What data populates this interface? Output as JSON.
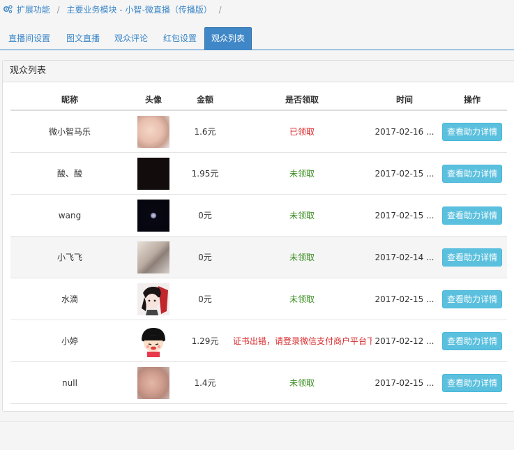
{
  "breadcrumb": {
    "items": [
      "扩展功能",
      "主要业务模块 - 小智-微直播（传播版）"
    ],
    "separator": "/"
  },
  "tabs": [
    {
      "label": "直播间设置",
      "active": false
    },
    {
      "label": "图文直播",
      "active": false
    },
    {
      "label": "观众评论",
      "active": false
    },
    {
      "label": "红包设置",
      "active": false
    },
    {
      "label": "观众列表",
      "active": true
    }
  ],
  "panel": {
    "title": "观众列表"
  },
  "table": {
    "headers": [
      "昵称",
      "头像",
      "金额",
      "是否领取",
      "时间",
      "操作"
    ],
    "rows": [
      {
        "nickname": "微小智马乐",
        "amount": "1.6元",
        "status": "已领取",
        "status_type": "ok",
        "time": "2017-02-16 ...",
        "action": "查看助力详情"
      },
      {
        "nickname": "酸、酸",
        "amount": "1.95元",
        "status": "未领取",
        "status_type": "no",
        "time": "2017-02-15 ...",
        "action": "查看助力详情"
      },
      {
        "nickname": "wang",
        "amount": "0元",
        "status": "未领取",
        "status_type": "no",
        "time": "2017-02-15 ...",
        "action": "查看助力详情"
      },
      {
        "nickname": "小飞飞",
        "amount": "0元",
        "status": "未领取",
        "status_type": "no",
        "time": "2017-02-14 ...",
        "action": "查看助力详情"
      },
      {
        "nickname": "水滴",
        "amount": "0元",
        "status": "未领取",
        "status_type": "no",
        "time": "2017-02-15 ...",
        "action": "查看助力详情"
      },
      {
        "nickname": "小婷",
        "amount": "1.29元",
        "status": "证书出错，请登录微信支付商户平台下...",
        "status_type": "err",
        "time": "2017-02-12 ...",
        "action": "查看助力详情"
      },
      {
        "nickname": "null",
        "amount": "1.4元",
        "status": "未领取",
        "status_type": "no",
        "time": "2017-02-15 ...",
        "action": "查看助力详情"
      }
    ]
  },
  "colors": {
    "accent": "#3a86c8",
    "button": "#5bc0de",
    "received": "#d9292b",
    "not_received": "#3b8d22"
  }
}
